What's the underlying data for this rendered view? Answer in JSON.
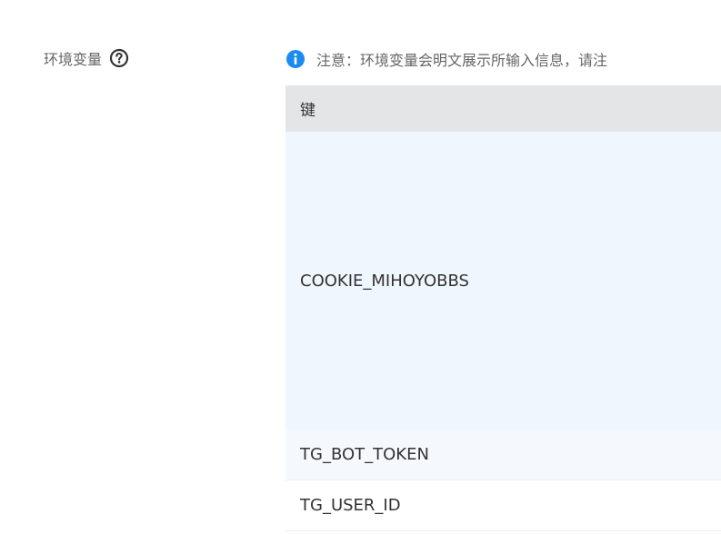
{
  "field": {
    "label": "环境变量",
    "help_icon": "question-circle-icon"
  },
  "notice": {
    "icon": "info-circle-icon",
    "text": "注意：环境变量会明文展示所输入信息，请注"
  },
  "table": {
    "columns": [
      "键"
    ],
    "rows": [
      {
        "key": "COOKIE_MIHOYOBBS"
      },
      {
        "key": "TG_BOT_TOKEN"
      },
      {
        "key": "TG_USER_ID"
      }
    ]
  },
  "colors": {
    "info_icon": "#1a8cf0",
    "label_text": "#666666",
    "header_bg": "#e3e5e7",
    "highlight_row_bg": "#f0f6fe"
  }
}
